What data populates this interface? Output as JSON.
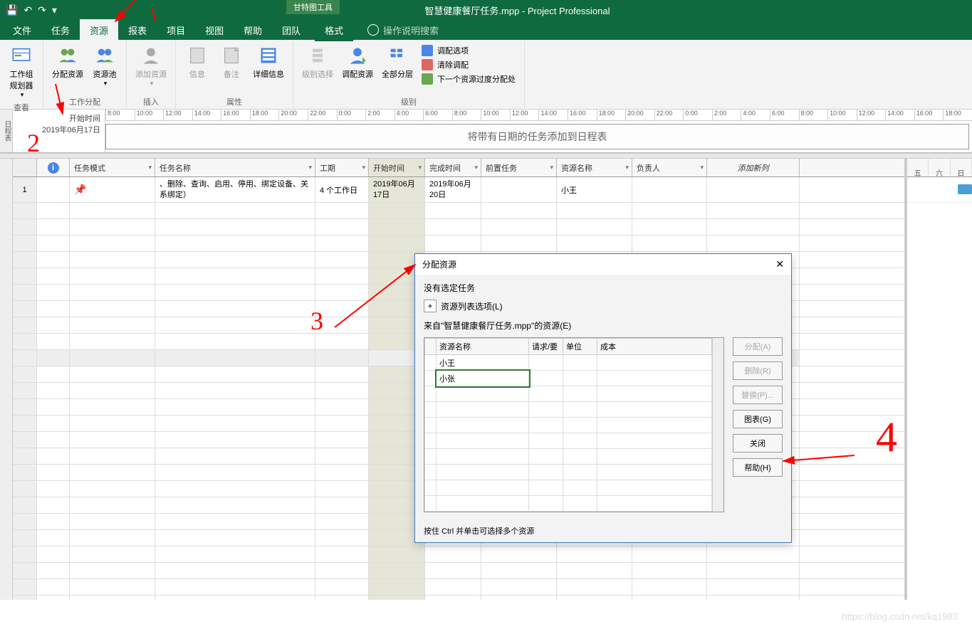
{
  "title": "智慧健康餐厅任务.mpp  -  Project Professional",
  "tool_tab": "甘特图工具",
  "tabs": {
    "file": "文件",
    "task": "任务",
    "resource": "资源",
    "report": "报表",
    "project": "项目",
    "view": "视图",
    "help": "帮助",
    "team": "团队",
    "format": "格式"
  },
  "tellme": "操作说明搜索",
  "ribbon": {
    "view_group": "查看",
    "planner": "工作组\n规划器",
    "assign_group": "工作分配",
    "assign": "分配资源",
    "pool": "资源池",
    "insert_group": "插入",
    "add_res": "添加资源",
    "props_group": "属性",
    "info": "信息",
    "notes": "备注",
    "details": "详细信息",
    "level_group": "级别",
    "level_sel": "级别选择",
    "level_res": "调配资源",
    "level_all": "全部分层",
    "opt1": "调配选项",
    "opt2": "清除调配",
    "opt3": "下一个资源过度分配处"
  },
  "timeline": {
    "side": "日程表",
    "start_label": "开始时间",
    "start_date": "2019年06月17日",
    "hours": [
      "8:00",
      "10:00",
      "12:00",
      "14:00",
      "16:00",
      "18:00",
      "20:00",
      "22:00",
      "0:00",
      "2:00",
      "4:00",
      "6:00",
      "8:00",
      "10:00",
      "12:00",
      "14:00",
      "16:00",
      "18:00",
      "20:00",
      "22:00",
      "0:00",
      "2:00",
      "4:00",
      "6:00",
      "8:00",
      "10:00",
      "12:00",
      "14:00",
      "16:00",
      "18:00"
    ],
    "msg": "将带有日期的任务添加到日程表"
  },
  "grid": {
    "headers": {
      "mode": "任务模式",
      "name": "任务名称",
      "dur": "工期",
      "start": "开始时间",
      "end": "完成时间",
      "pred": "前置任务",
      "res": "资源名称",
      "owner": "负责人",
      "add": "添加新列"
    },
    "row1": {
      "idx": "1",
      "name": "、删除、查询、启用、停用、绑定设备、关系绑定）",
      "dur": "4 个工作日",
      "start": "2019年06月17日",
      "end": "2019年06月20日",
      "res": "小王"
    },
    "gantt_days": [
      "五",
      "六",
      "日"
    ]
  },
  "dialog": {
    "title": "分配资源",
    "no_task": "没有选定任务",
    "options": "资源列表选项(L)",
    "from": "来自\"智慧健康餐厅任务.mpp\"的资源(E)",
    "th": {
      "name": "资源名称",
      "req": "请求/要",
      "unit": "单位",
      "cost": "成本"
    },
    "r1": "小王",
    "r2": "小张",
    "btn_assign": "分配(A)",
    "btn_del": "删除(R)",
    "btn_replace": "替换(P)...",
    "btn_chart": "图表(G)",
    "btn_close": "关闭",
    "btn_help": "帮助(H)",
    "foot": "按住 Ctrl 并单击可选择多个资源"
  },
  "watermark": "https://blog.csdn.net/kq1983"
}
